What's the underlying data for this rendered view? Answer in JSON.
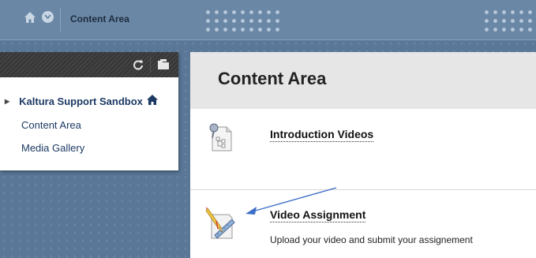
{
  "breadcrumb": {
    "home_icon": "home-icon",
    "menu_icon": "chevron-down-icon",
    "current": "Content Area"
  },
  "course_menu": {
    "refresh_icon": "refresh-icon",
    "folder_icon": "folder-icon",
    "course_name": "Kaltura Support Sandbox",
    "items": [
      {
        "label": "Content Area"
      },
      {
        "label": "Media Gallery"
      }
    ]
  },
  "content": {
    "title": "Content Area",
    "items": [
      {
        "title": "Introduction Videos",
        "description": "",
        "icon": "item-document-icon"
      },
      {
        "title": "Video Assignment",
        "description": "Upload your video and submit your assignement",
        "icon": "assignment-icon"
      }
    ]
  },
  "colors": {
    "background": "#5a7797",
    "link": "#1c3a63",
    "annotation_arrow": "#3d6fc8"
  }
}
